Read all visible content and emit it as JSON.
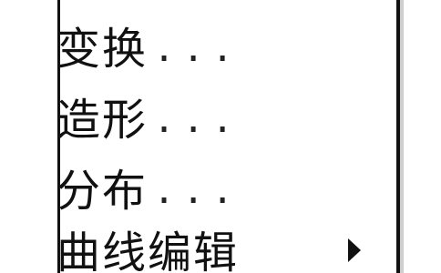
{
  "menu": {
    "items": [
      {
        "label": "变换",
        "ellipsis": "...",
        "has_submenu": false
      },
      {
        "label": "造形",
        "ellipsis": "...",
        "has_submenu": false
      },
      {
        "label": "分布",
        "ellipsis": "...",
        "has_submenu": false
      },
      {
        "label": "曲线编辑",
        "ellipsis": "",
        "has_submenu": true,
        "submenu_icon": "triangle-right-icon"
      }
    ]
  }
}
